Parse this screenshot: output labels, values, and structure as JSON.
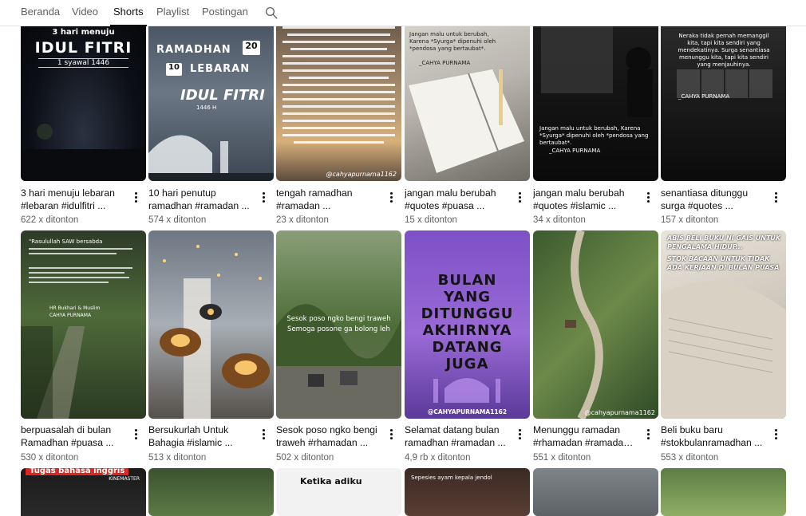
{
  "tabs": [
    {
      "label": "Beranda"
    },
    {
      "label": "Video"
    },
    {
      "label": "Shorts"
    },
    {
      "label": "Playlist"
    },
    {
      "label": "Postingan"
    }
  ],
  "active_tab": "Shorts",
  "rows": [
    [
      {
        "title": "3 hari menuju lebaran #lebaran #idulfitri ...",
        "views": "622 x ditonton",
        "overlay": [
          "3 hari menuju",
          "IDUL FITRI",
          "1 syawal 1446"
        ]
      },
      {
        "title": "10 hari penutup ramadhan #ramadan ...",
        "views": "574 x ditonton",
        "overlay": [
          "RAMADHAN",
          "LEBARAN",
          "IDUL FITRI",
          "1446 H",
          "20",
          "10"
        ]
      },
      {
        "title": "tengah ramadhan #ramadan ...",
        "views": "23 x ditonton",
        "overlay": [
          "@cahyapurnama1162"
        ]
      },
      {
        "title": "jangan malu berubah #quotes #puasa ...",
        "views": "15 x ditonton",
        "overlay": [
          "Jangan malu untuk berubah, Karena *Syurga* dipenuhi oleh *pendosa yang bertaubat*.",
          "_CAHYA PURNAMA"
        ]
      },
      {
        "title": "jangan malu berubah #quotes #islamic ...",
        "views": "34 x ditonton",
        "overlay": [
          "Jangan malu untuk berubah, Karena *Syurga* dipenuhi oleh *pendosa yang bertaubat*.",
          "_CAHYA PURNAMA"
        ]
      },
      {
        "title": "senantiasa ditunggu surga #quotes ...",
        "views": "157 x ditonton",
        "overlay": [
          "Neraka tidak pernah memanggil kita, tapi kita sendiri yang mendekatinya. Surga senantiasa menunggu kita, tapi kita sendiri yang menjauhinya.",
          "_CAHYA PURNAMA"
        ]
      }
    ],
    [
      {
        "title": "berpuasalah di bulan Ramadhan #puasa ...",
        "views": "530 x ditonton",
        "overlay": [
          "\"Rasulullah SAW bersabda",
          "HR Bukhari & Muslim",
          "CAHYA PURNAMA"
        ]
      },
      {
        "title": "Bersukurlah Untuk Bahagia #islamic ...",
        "views": "513 x ditonton",
        "overlay": []
      },
      {
        "title": "Sesok poso ngko bengi traweh #rhamadan ...",
        "views": "502 x ditonton",
        "overlay": [
          "Sesok poso ngko bengi traweh",
          "Semoga posone ga bolong leh"
        ]
      },
      {
        "title": "Selamat datang bulan ramadhan #ramadan ...",
        "views": "4,9 rb x ditonton",
        "overlay": [
          "BULAN",
          "YANG",
          "DITUNGGU",
          "AKHIRNYA",
          "DATANG",
          "JUGA",
          "@CAHYAPURNAMA1162"
        ]
      },
      {
        "title": "Menunggu ramadan #rhamadan #ramadan ...",
        "views": "551 x ditonton",
        "overlay": [
          "@cahyapurnama1162"
        ]
      },
      {
        "title": "Beli buku baru #stokbulanramadhan ...",
        "views": "553 x ditonton",
        "overlay": [
          "ABIS BELI BUKU NI GAIS UNTUK PENGALAMA HIDUP...",
          "STOK BACAAN UNTUK TIDAK ADA KERJAAN DI BULAN PUASA"
        ]
      }
    ],
    [
      {
        "overlay": [
          "Tugas bahasa inggris",
          "KINEMASTER"
        ]
      },
      {
        "overlay": []
      },
      {
        "overlay": [
          "Ketika adiku"
        ]
      },
      {
        "overlay": [
          "Sepesies ayam kepala jendol"
        ]
      },
      {
        "overlay": []
      },
      {
        "overlay": []
      }
    ]
  ],
  "icons": {
    "search": "search-icon",
    "more": "more-vert-icon"
  }
}
